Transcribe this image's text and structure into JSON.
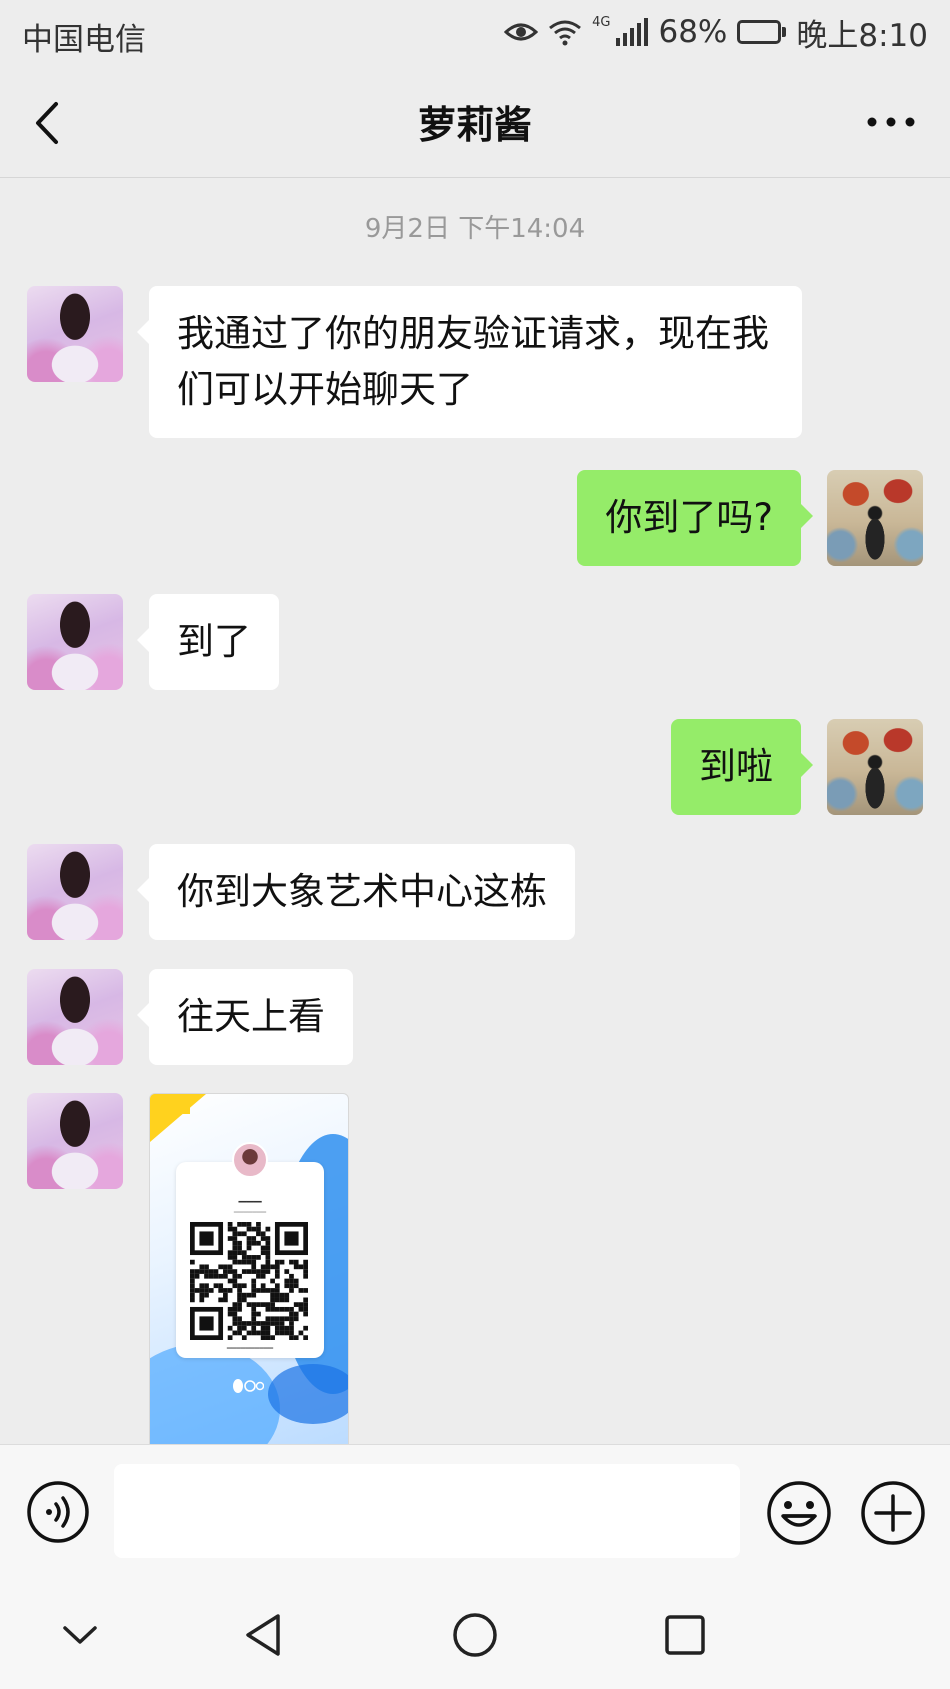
{
  "status_bar": {
    "carrier": "中国电信",
    "network": "4G",
    "battery": "68%",
    "battery_level": 0.68,
    "time": "晚上8:10"
  },
  "header": {
    "title": "萝莉酱",
    "back_icon": "chevron-left-icon",
    "more_icon": "more-dots-icon"
  },
  "chat": {
    "timestamp": "9月2日 下午14:04",
    "messages": [
      {
        "side": "left",
        "text": "我通过了你的朋友验证请求，现在我们可以开始聊天了"
      },
      {
        "side": "right",
        "text": "你到了吗?"
      },
      {
        "side": "left",
        "text": "到了"
      },
      {
        "side": "right",
        "text": "到啦"
      },
      {
        "side": "left",
        "text": "你到大象艺术中心这栋"
      },
      {
        "side": "left",
        "text": "往天上看"
      },
      {
        "side": "left",
        "type": "image",
        "image": "qq-qr-code-card"
      }
    ]
  },
  "input_bar": {
    "voice_icon": "voice-icon",
    "input_value": "",
    "emoji_icon": "emoji-icon",
    "plus_icon": "plus-circle-icon"
  },
  "system_nav": {
    "icons": [
      "chevron-down-icon",
      "back-triangle-icon",
      "home-circle-icon",
      "recents-square-icon"
    ]
  },
  "colors": {
    "background": "#ededed",
    "sent_bubble": "#95ec69",
    "received_bubble": "#ffffff"
  }
}
